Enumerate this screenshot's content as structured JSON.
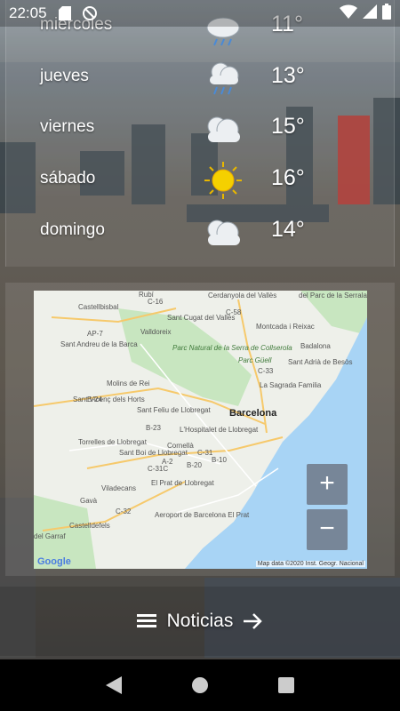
{
  "status_bar": {
    "time": "22:05"
  },
  "forecast": [
    {
      "day": "miércoles",
      "temp": "11°",
      "icon": "rain-cloud-icon"
    },
    {
      "day": "jueves",
      "temp": "13°",
      "icon": "rain-cloud-icon"
    },
    {
      "day": "viernes",
      "temp": "15°",
      "icon": "cloud-icon"
    },
    {
      "day": "sábado",
      "temp": "16°",
      "icon": "sun-icon"
    },
    {
      "day": "domingo",
      "temp": "14°",
      "icon": "cloud-icon"
    }
  ],
  "map": {
    "city": "Barcelona",
    "labels": [
      "Rubí",
      "Cerdanyola del Vallès",
      "del Parc de la Serralada de Marina",
      "Castellbisbal",
      "Sant Cugat del Vallès",
      "Montcada i Reixac",
      "Valldoreix",
      "Sant Andreu de la Barca",
      "Parc Natural de la Serra de Collserola",
      "Parc Güell",
      "Badalona",
      "Sant Adrià de Besòs",
      "Molins de Rei",
      "La Sagrada Familia",
      "Sant Vicenç dels Horts",
      "Sant Feliu de Llobregat",
      "Barcelona",
      "L'Hospitalet de Llobregat",
      "Torrelles de Llobregat",
      "Sant Boi de Llobregat",
      "Cornellà",
      "El Prat de Llobregat",
      "Viladecans",
      "Gavà",
      "Castelldefels",
      "Aeroport de Barcelona El Prat",
      "del Garraf"
    ],
    "roads": [
      "C-16",
      "AP-7",
      "C-58",
      "B-24",
      "B-23",
      "C-32",
      "B-20",
      "C-31",
      "C-31C",
      "C-33",
      "A-2",
      "B-10"
    ],
    "attribution": "Map data ©2020 Inst. Geogr. Nacional",
    "google": "Google",
    "zoom_in": "+",
    "zoom_out": "−"
  },
  "news": {
    "label": "Noticias"
  },
  "colors": {
    "water": "#a8d4f5",
    "land": "#eef0ea",
    "park": "#c8e6c0",
    "accent": "#ffffff"
  }
}
